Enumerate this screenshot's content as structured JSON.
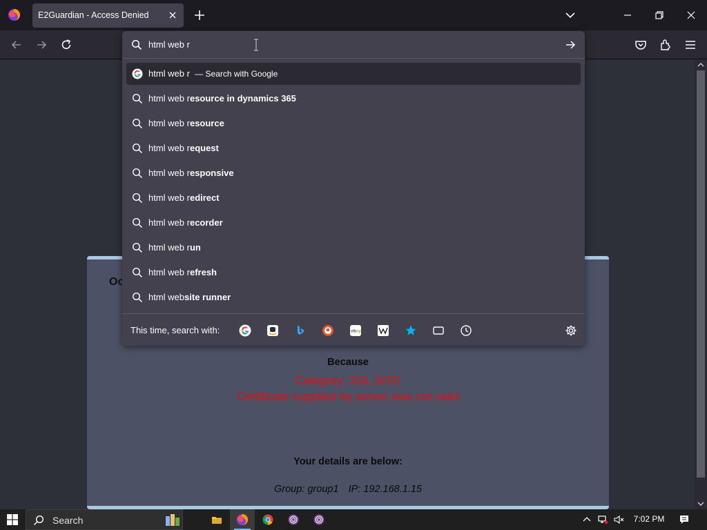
{
  "browser": {
    "tab_title": "E2Guardian - Access Denied"
  },
  "urlbar": {
    "typed_text": "html web r"
  },
  "suggestions": [
    {
      "prefix": "html web r",
      "completion": "",
      "action": "— Search with Google",
      "icon": "google-icon",
      "selected": true
    },
    {
      "prefix": "html web r",
      "completion": "esource in dynamics 365",
      "icon": "search-icon"
    },
    {
      "prefix": "html web r",
      "completion": "esource",
      "icon": "search-icon"
    },
    {
      "prefix": "html web r",
      "completion": "equest",
      "icon": "search-icon"
    },
    {
      "prefix": "html web r",
      "completion": "esponsive",
      "icon": "search-icon"
    },
    {
      "prefix": "html web r",
      "completion": "edirect",
      "icon": "search-icon"
    },
    {
      "prefix": "html web r",
      "completion": "ecorder",
      "icon": "search-icon"
    },
    {
      "prefix": "html web r",
      "completion": "un",
      "icon": "search-icon"
    },
    {
      "prefix": "html web r",
      "completion": "efresh",
      "icon": "search-icon"
    },
    {
      "prefix": "html web",
      "completion": "site r",
      "suffix": "unner",
      "icon": "search-icon"
    }
  ],
  "one_off": {
    "label": "This time, search with:",
    "engines": [
      "google",
      "amazon",
      "bing",
      "duckduckgo",
      "ebay",
      "wikipedia",
      "bookmarks",
      "tabs",
      "history"
    ]
  },
  "page": {
    "heading_fragment": "Oo",
    "because": "Because",
    "reason_lines": [
      "Category: SSL SITE",
      "Certificate supplied by server was not valid"
    ],
    "details_heading": "Your details are below:",
    "group": "Group: group1",
    "ip": "IP: 192.168.1.15"
  },
  "taskbar": {
    "search_placeholder": "Search",
    "time": "7:02 PM"
  },
  "colors": {
    "reason_red": "#e30f12",
    "card_bg": "#4c5166",
    "card_border": "#a9c8e6"
  }
}
